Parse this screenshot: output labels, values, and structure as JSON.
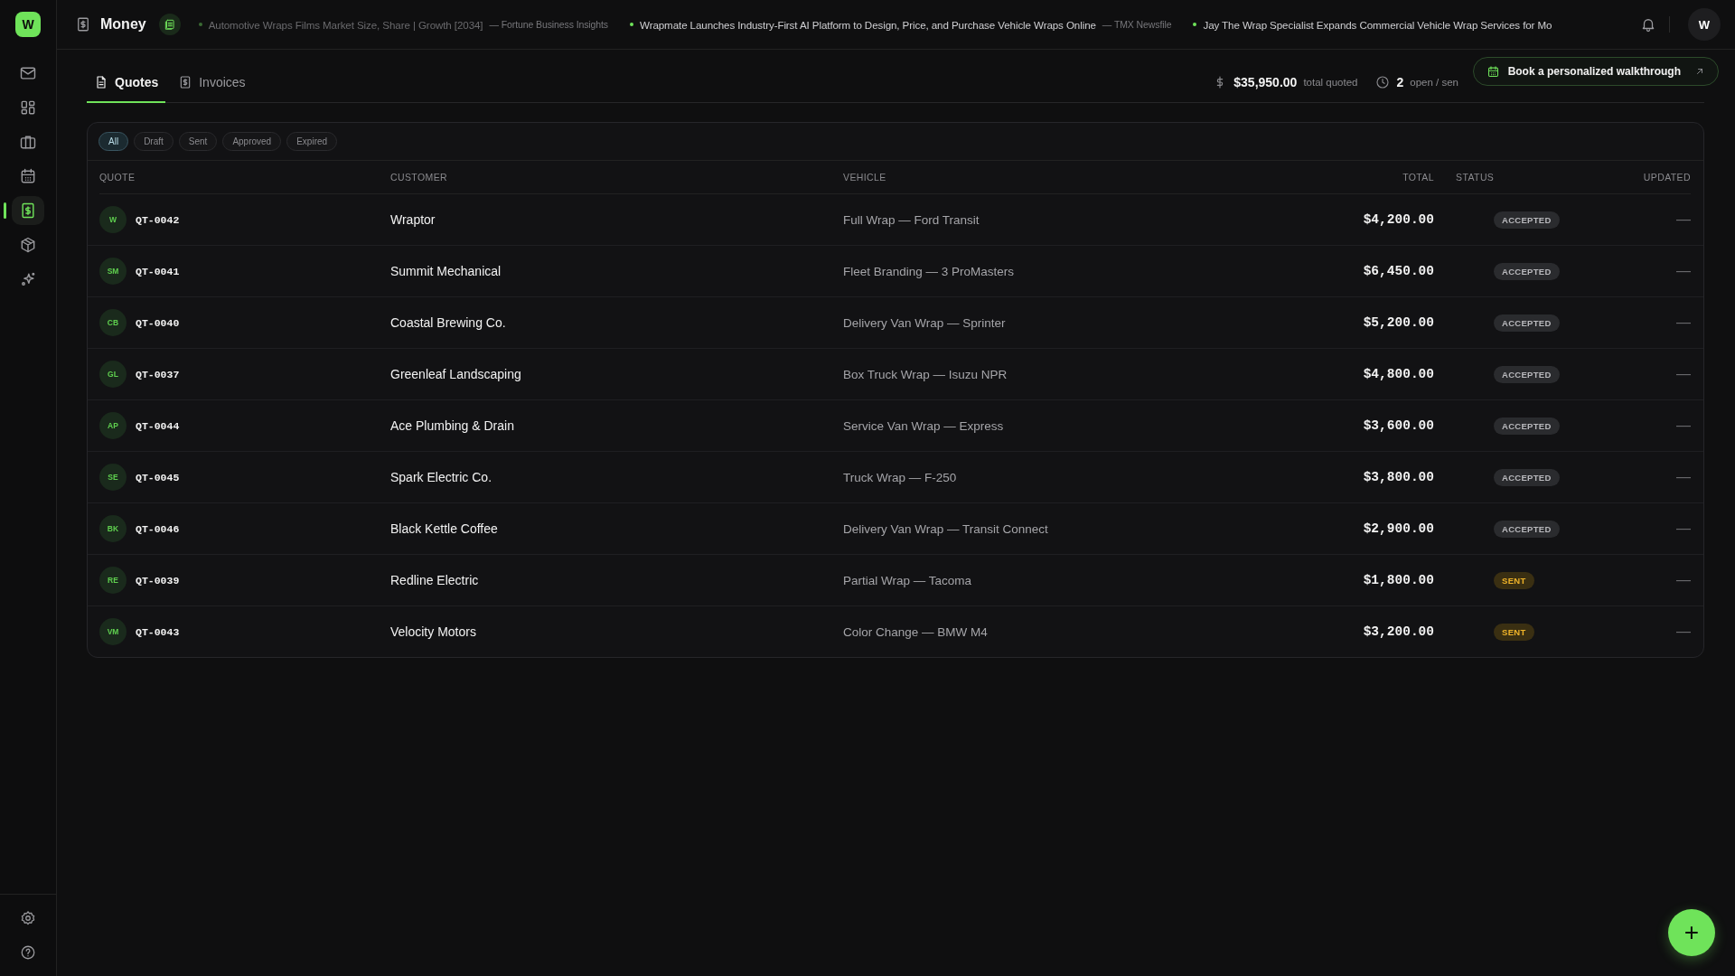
{
  "app_logo": "W",
  "sidebar": {
    "items": [
      {
        "selected": false
      },
      {
        "selected": false
      },
      {
        "selected": false
      },
      {
        "selected": false
      },
      {
        "selected": true
      },
      {
        "selected": false
      },
      {
        "selected": false
      }
    ]
  },
  "topbar": {
    "title": "Money",
    "news": [
      {
        "headline": "Automotive Wraps Films Market Size, Share | Growth [2034]",
        "source": "— Fortune Business Insights"
      },
      {
        "headline": "Wrapmate Launches Industry-First AI Platform to Design, Price, and Purchase Vehicle Wraps Online",
        "source": "— TMX Newsfile"
      },
      {
        "headline": "Jay The Wrap Specialist Expands Commercial Vehicle Wrap Services for Mo"
      }
    ],
    "avatar": "W"
  },
  "tabs": [
    {
      "label": "Quotes",
      "selected": true
    },
    {
      "label": "Invoices",
      "selected": false
    }
  ],
  "stats": [
    {
      "value": "$35,950.00",
      "label": "total quoted"
    },
    {
      "value": "2",
      "label": "open / sen"
    }
  ],
  "walkthrough_button": "Book a personalized walkthrough",
  "filters": [
    {
      "label": "All",
      "selected": true
    },
    {
      "label": "Draft",
      "selected": false
    },
    {
      "label": "Sent",
      "selected": false
    },
    {
      "label": "Approved",
      "selected": false
    },
    {
      "label": "Expired",
      "selected": false
    }
  ],
  "table": {
    "columns": [
      "QUOTE",
      "CUSTOMER",
      "VEHICLE",
      "TOTAL",
      "STATUS",
      "UPDATED"
    ],
    "rows": [
      {
        "initials": "W",
        "quote": "QT-0042",
        "customer": "Wraptor",
        "vehicle": "Full Wrap — Ford Transit",
        "total": "$4,200.00",
        "status": {
          "kind": "accepted",
          "label": "ACCEPTED"
        },
        "updated": "—"
      },
      {
        "initials": "SM",
        "quote": "QT-0041",
        "customer": "Summit Mechanical",
        "vehicle": "Fleet Branding — 3 ProMasters",
        "total": "$6,450.00",
        "status": {
          "kind": "accepted",
          "label": "ACCEPTED"
        },
        "updated": "—"
      },
      {
        "initials": "CB",
        "quote": "QT-0040",
        "customer": "Coastal Brewing Co.",
        "vehicle": "Delivery Van Wrap — Sprinter",
        "total": "$5,200.00",
        "status": {
          "kind": "accepted",
          "label": "ACCEPTED"
        },
        "updated": "—"
      },
      {
        "initials": "GL",
        "quote": "QT-0037",
        "customer": "Greenleaf Landscaping",
        "vehicle": "Box Truck Wrap — Isuzu NPR",
        "total": "$4,800.00",
        "status": {
          "kind": "accepted",
          "label": "ACCEPTED"
        },
        "updated": "—"
      },
      {
        "initials": "AP",
        "quote": "QT-0044",
        "customer": "Ace Plumbing & Drain",
        "vehicle": "Service Van Wrap — Express",
        "total": "$3,600.00",
        "status": {
          "kind": "accepted",
          "label": "ACCEPTED"
        },
        "updated": "—"
      },
      {
        "initials": "SE",
        "quote": "QT-0045",
        "customer": "Spark Electric Co.",
        "vehicle": "Truck Wrap — F-250",
        "total": "$3,800.00",
        "status": {
          "kind": "accepted",
          "label": "ACCEPTED"
        },
        "updated": "—"
      },
      {
        "initials": "BK",
        "quote": "QT-0046",
        "customer": "Black Kettle Coffee",
        "vehicle": "Delivery Van Wrap — Transit Connect",
        "total": "$2,900.00",
        "status": {
          "kind": "accepted",
          "label": "ACCEPTED"
        },
        "updated": "—"
      },
      {
        "initials": "RE",
        "quote": "QT-0039",
        "customer": "Redline Electric",
        "vehicle": "Partial Wrap — Tacoma",
        "total": "$1,800.00",
        "status": {
          "kind": "sent",
          "label": "SENT"
        },
        "updated": "—"
      },
      {
        "initials": "VM",
        "quote": "QT-0043",
        "customer": "Velocity Motors",
        "vehicle": "Color Change — BMW M4",
        "total": "$3,200.00",
        "status": {
          "kind": "sent",
          "label": "SENT"
        },
        "updated": "—"
      }
    ]
  },
  "fab": "+"
}
